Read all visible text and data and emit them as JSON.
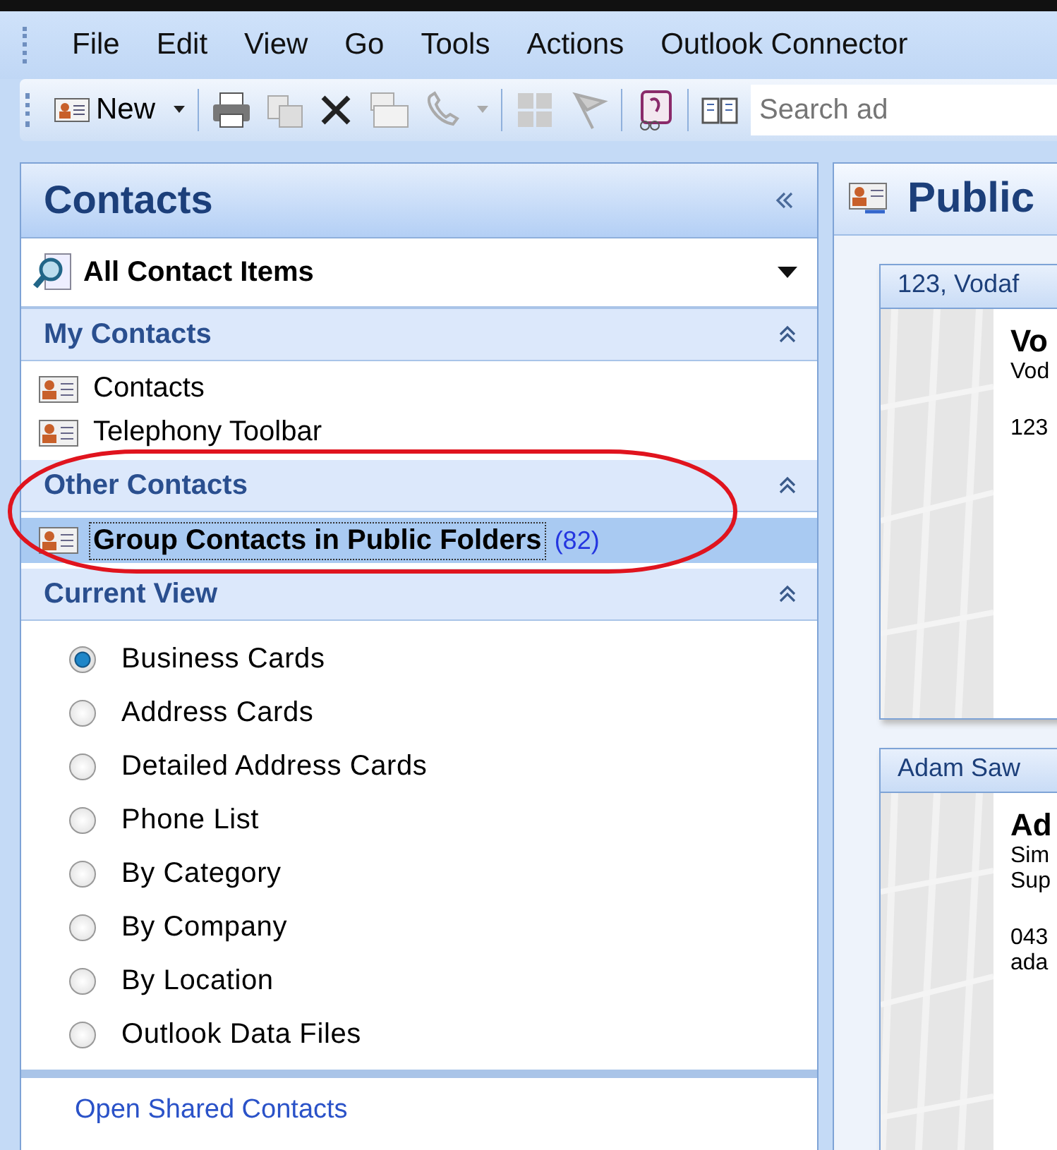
{
  "menu": [
    "File",
    "Edit",
    "View",
    "Go",
    "Tools",
    "Actions",
    "Outlook Connector"
  ],
  "toolbar": {
    "new_label": "New",
    "search": {
      "placeholder": "Search ad"
    }
  },
  "navigation": {
    "title": "Contacts",
    "view_selector": {
      "value": "All Contact Items"
    },
    "sections": [
      {
        "title": "My Contacts",
        "expanded": true,
        "items": [
          {
            "label": "Contacts",
            "selected": false
          },
          {
            "label": "Telephony Toolbar",
            "selected": false
          }
        ]
      },
      {
        "title": "Other Contacts",
        "expanded": true,
        "items": [
          {
            "label": "Group Contacts in Public Folders",
            "selected": true,
            "count": "(82)"
          }
        ]
      }
    ],
    "current_view": {
      "title": "Current View",
      "expanded": true,
      "options": [
        {
          "label": "Business Cards",
          "selected": true
        },
        {
          "label": "Address Cards",
          "selected": false
        },
        {
          "label": "Detailed Address Cards",
          "selected": false
        },
        {
          "label": "Phone List",
          "selected": false
        },
        {
          "label": "By Category",
          "selected": false
        },
        {
          "label": "By Company",
          "selected": false
        },
        {
          "label": "By Location",
          "selected": false
        },
        {
          "label": "Outlook Data Files",
          "selected": false
        }
      ]
    },
    "link": "Open Shared Contacts"
  },
  "content": {
    "title": "Public",
    "cards": [
      {
        "header": "123, Vodaf",
        "name": "Vo",
        "groups": [
          [
            "Vod"
          ],
          [
            "123"
          ]
        ]
      },
      {
        "header": "Adam Saw",
        "name": "Ad",
        "groups": [
          [
            "Sim",
            "Sup"
          ],
          [
            "043",
            "ada"
          ]
        ]
      }
    ]
  }
}
